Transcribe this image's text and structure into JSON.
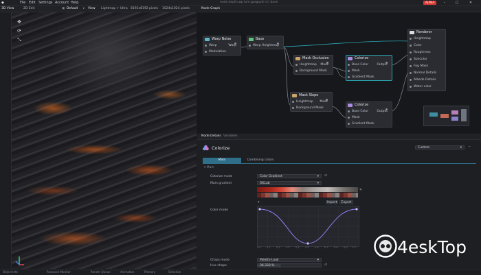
{
  "menubar": {
    "items": [
      "File",
      "Edit",
      "Settings",
      "Account",
      "Help"
    ],
    "title": "node.depth.wp lore.gargoyle (c) base",
    "alpha_badge": "ALPHA"
  },
  "viewport_toolbar": {
    "view_tab": "3D View",
    "edit_tab": "2D Edit",
    "default": "Default",
    "view": "View",
    "lighting": "Lightmap + Ultra",
    "resolution": "8192x8192 pixels",
    "resolution2": "1024x1024 pixels"
  },
  "node_graph": {
    "header": "Node Graph",
    "nodes": {
      "warp_noise": {
        "title": "Warp Noise",
        "rows": [
          {
            "l": "Warp",
            "r": "Warp"
          },
          {
            "l": "Modulation",
            "r": ""
          }
        ]
      },
      "base": {
        "title": "Base",
        "rows": [
          {
            "l": "Warp",
            "r": "Heightmap"
          }
        ]
      },
      "mask_occlusion": {
        "title": "Mask Occlusion",
        "rows": [
          {
            "l": "Heightmap",
            "r": "Mask"
          },
          {
            "l": "Background Mask",
            "r": ""
          }
        ]
      },
      "colorize1": {
        "title": "Colorize",
        "rows": [
          {
            "l": "Base Color",
            "r": "Output"
          },
          {
            "l": "Mask",
            "r": ""
          },
          {
            "l": "Gradient Mask",
            "r": ""
          }
        ]
      },
      "mask_slope": {
        "title": "Mask Slope",
        "rows": [
          {
            "l": "Heightmap",
            "r": "Mask"
          },
          {
            "l": "Background Mask",
            "r": ""
          }
        ]
      },
      "colorize2": {
        "title": "Colorize",
        "rows": [
          {
            "l": "Base Color",
            "r": "Output"
          },
          {
            "l": "Mask",
            "r": ""
          },
          {
            "l": "Gradient Mask",
            "r": ""
          }
        ]
      },
      "renderer": {
        "title": "Renderer",
        "rows": [
          "Heightmap",
          "Color",
          "Roughness",
          "Specular",
          "Fog Mask",
          "Normal Details",
          "Albedo Details",
          "Water color"
        ]
      }
    }
  },
  "node_details": {
    "tabs": [
      "Node Details",
      "Variables"
    ],
    "node_title": "Colorize",
    "preset": "Custom",
    "subtabs": [
      "Main",
      "Combining colors"
    ],
    "section": "Main",
    "colorize_mode_label": "Colorize mode",
    "colorize_mode_value": "Color Gradient",
    "main_gradient_label": "Main gradient",
    "main_gradient_value": "OKLab",
    "color_mode_label": "Color mode",
    "import_button": "Import",
    "export_button": "Export",
    "chaos_mode_label": "Chaos mode",
    "chaos_mode_value": "Palette Look",
    "hue_shape_label": "Hue shape",
    "hue_shape_value": "36.333 %",
    "curve_x_ticks": [
      "0.0",
      "0.1",
      "0.2",
      "0.3",
      "0.4",
      "0.5",
      "0.6",
      "0.7",
      "0.8",
      "0.9",
      "1.0"
    ]
  },
  "statusbar": {
    "items": [
      "Object Info",
      "Resource Monitor",
      "Render Queue",
      "Animation",
      "Memory",
      "Selection"
    ]
  },
  "watermark": {
    "text": "4eskTop"
  },
  "colors": {
    "accent": "#2aa7b5",
    "alpha": "#d73a35",
    "lava": "#ff7a1e"
  }
}
